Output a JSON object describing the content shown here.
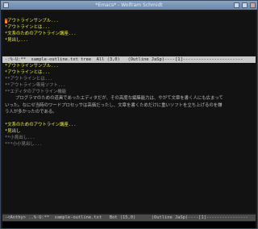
{
  "window": {
    "title": "*Emacs* - Wolfram Schmidt"
  },
  "pane_top": {
    "lines": [
      {
        "text": "",
        "color": "yellow"
      },
      {
        "text": "*アウトラインサンプル...",
        "color": "yellow",
        "cursor": true
      },
      {
        "text": "*アウトラインとは...",
        "color": "yellow"
      },
      {
        "text": "*文系のためのアウトライン講座...",
        "color": "yellow"
      },
      {
        "text": "*見出し...",
        "color": "yellow"
      }
    ]
  },
  "modeline_top": {
    "text": "-:%-U:**  sample-outline.txt tree  All (3,0)   (Outline JaSp)----[1]-----------------------"
  },
  "pane_bottom": {
    "lines": [
      {
        "text": "*アウトラインサンプル...",
        "color": "yellow"
      },
      {
        "text": "*アウトラインとは...",
        "color": "yellow"
      },
      {
        "text": "**アウトラインとは...",
        "color": "gray"
      },
      {
        "text": "**アウトライン専用ソフト...",
        "color": "gray"
      },
      {
        "text": "**エディタのアウトライン機能",
        "color": "gray"
      },
      {
        "text": "    プログラマのための道具であったエディタだが、その高度な編集能力は、やがて文章を書く人にも広まって",
        "color": "light"
      },
      {
        "text": "いった。なにせ当時のワードプロセッサは高価だったし、文章を書くためだけに重いソフトを立ち上げるのを嫌",
        "color": "light"
      },
      {
        "text": "う人が多かったのである。",
        "color": "light"
      },
      {
        "text": "",
        "color": "light"
      },
      {
        "text": "*文系のためのアウトライン講座...",
        "color": "yellow"
      },
      {
        "text": "*見出し",
        "color": "yellow"
      },
      {
        "text": "**小見出し...",
        "color": "gray"
      },
      {
        "text": "***小小見出し...",
        "color": "gray"
      }
    ]
  },
  "modeline_bottom": {
    "text": "-<Anthy> ..%-U:**  sample-outline.txt   Bot (15,0)      (Outline JaSp)----[1]----------------"
  }
}
